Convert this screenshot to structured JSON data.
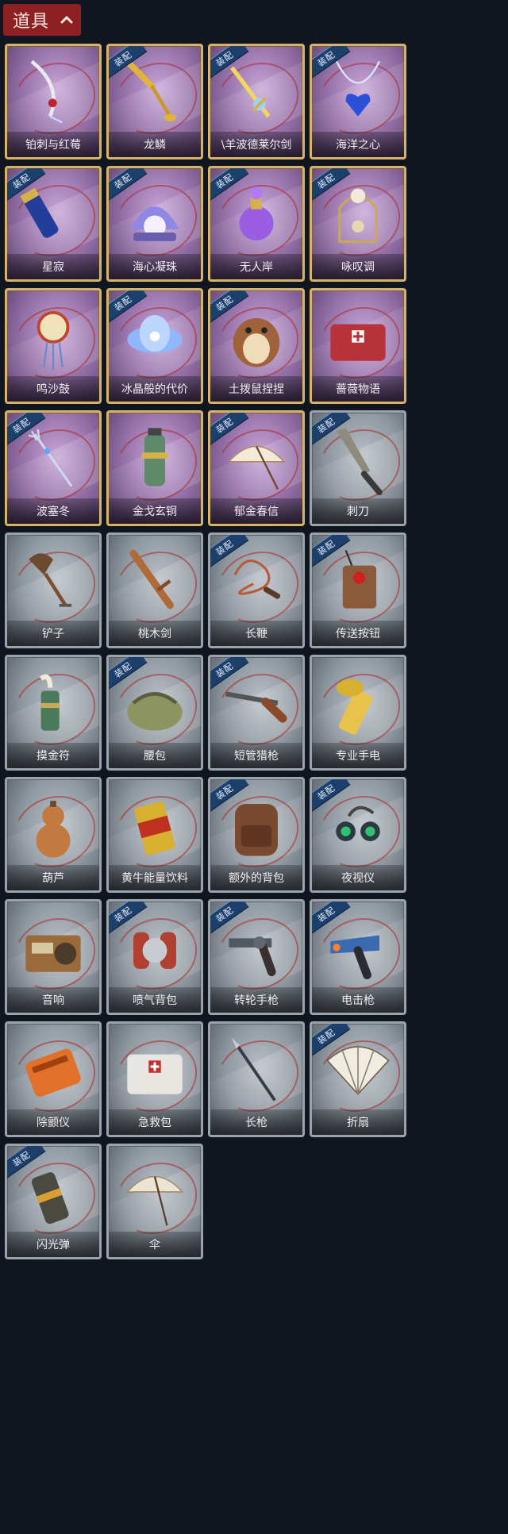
{
  "header": {
    "title": "道具"
  },
  "colors": {
    "header_bg": "#8e1f22",
    "rare_border": "#d6b26a",
    "rare_bg": "#9b76ad",
    "common_bg": "#8f979f",
    "badge_bg": "#1d3f6b"
  },
  "items": [
    {
      "name": "铂刺与红莓",
      "rarity": "rare",
      "equipped": false,
      "icon": "blade-icon"
    },
    {
      "name": "龙鳞",
      "rarity": "rare",
      "equipped": true,
      "badge": "装配",
      "icon": "golden-shovel-icon"
    },
    {
      "name": "\\羊波德莱尔剑",
      "rarity": "rare",
      "equipped": true,
      "badge": "装配",
      "icon": "sword-icon"
    },
    {
      "name": "海洋之心",
      "rarity": "rare",
      "equipped": true,
      "badge": "装配",
      "icon": "heart-necklace-icon"
    },
    {
      "name": "星寂",
      "rarity": "rare",
      "equipped": true,
      "badge": "装配",
      "icon": "flashlight-icon"
    },
    {
      "name": "海心凝珠",
      "rarity": "rare",
      "equipped": true,
      "badge": "装配",
      "icon": "pearl-shell-icon"
    },
    {
      "name": "无人岸",
      "rarity": "rare",
      "equipped": true,
      "badge": "装配",
      "icon": "perfume-bottle-icon"
    },
    {
      "name": "咏叹调",
      "rarity": "rare",
      "equipped": true,
      "badge": "装配",
      "icon": "birdcage-icon"
    },
    {
      "name": "鸣沙鼓",
      "rarity": "rare",
      "equipped": false,
      "icon": "drum-charm-icon"
    },
    {
      "name": "冰晶般的代价",
      "rarity": "rare",
      "equipped": true,
      "badge": "装配",
      "icon": "lotus-icon"
    },
    {
      "name": "土拨鼠捏捏",
      "rarity": "rare",
      "equipped": true,
      "badge": "装配",
      "icon": "hamster-icon"
    },
    {
      "name": "蔷薇物语",
      "rarity": "rare",
      "equipped": false,
      "icon": "medkit-icon"
    },
    {
      "name": "波塞冬",
      "rarity": "rare",
      "equipped": true,
      "badge": "装配",
      "icon": "trident-icon"
    },
    {
      "name": "金戈玄铜",
      "rarity": "rare",
      "equipped": false,
      "icon": "grenade-icon"
    },
    {
      "name": "郁金春信",
      "rarity": "rare",
      "equipped": true,
      "badge": "装配",
      "icon": "umbrella-icon"
    },
    {
      "name": "刺刀",
      "rarity": "common",
      "equipped": true,
      "badge": "装配",
      "icon": "knife-icon"
    },
    {
      "name": "铲子",
      "rarity": "common",
      "equipped": false,
      "icon": "shovel-icon"
    },
    {
      "name": "桃木剑",
      "rarity": "common",
      "equipped": false,
      "icon": "wooden-sword-icon"
    },
    {
      "name": "长鞭",
      "rarity": "common",
      "equipped": true,
      "badge": "装配",
      "icon": "whip-icon"
    },
    {
      "name": "传送按钮",
      "rarity": "common",
      "equipped": true,
      "badge": "装配",
      "icon": "remote-icon"
    },
    {
      "name": "摸金符",
      "rarity": "common",
      "equipped": false,
      "icon": "talisman-icon"
    },
    {
      "name": "腰包",
      "rarity": "common",
      "equipped": true,
      "badge": "装配",
      "icon": "bag-icon"
    },
    {
      "name": "短管猎枪",
      "rarity": "common",
      "equipped": true,
      "badge": "装配",
      "icon": "shotgun-icon"
    },
    {
      "name": "专业手电",
      "rarity": "common",
      "equipped": false,
      "icon": "torch-icon"
    },
    {
      "name": "葫芦",
      "rarity": "common",
      "equipped": false,
      "icon": "gourd-icon"
    },
    {
      "name": "黄牛能量饮料",
      "rarity": "common",
      "equipped": false,
      "icon": "can-icon"
    },
    {
      "name": "额外的背包",
      "rarity": "common",
      "equipped": true,
      "badge": "装配",
      "icon": "backpack-icon"
    },
    {
      "name": "夜视仪",
      "rarity": "common",
      "equipped": true,
      "badge": "装配",
      "icon": "goggles-icon"
    },
    {
      "name": "音响",
      "rarity": "common",
      "equipped": false,
      "icon": "radio-icon"
    },
    {
      "name": "喷气背包",
      "rarity": "common",
      "equipped": true,
      "badge": "装配",
      "icon": "jetpack-icon"
    },
    {
      "name": "转轮手枪",
      "rarity": "common",
      "equipped": true,
      "badge": "装配",
      "icon": "revolver-icon"
    },
    {
      "name": "电击枪",
      "rarity": "common",
      "equipped": true,
      "badge": "装配",
      "icon": "taser-icon"
    },
    {
      "name": "除颤仪",
      "rarity": "common",
      "equipped": false,
      "icon": "defibrillator-icon"
    },
    {
      "name": "急救包",
      "rarity": "common",
      "equipped": false,
      "icon": "firstaid-icon"
    },
    {
      "name": "长枪",
      "rarity": "common",
      "equipped": false,
      "icon": "spear-icon"
    },
    {
      "name": "折扇",
      "rarity": "common",
      "equipped": true,
      "badge": "装配",
      "icon": "fan-icon"
    },
    {
      "name": "闪光弹",
      "rarity": "common",
      "equipped": true,
      "badge": "装配",
      "icon": "flashbang-icon"
    },
    {
      "name": "伞",
      "rarity": "common",
      "equipped": false,
      "icon": "parasol-icon"
    }
  ]
}
